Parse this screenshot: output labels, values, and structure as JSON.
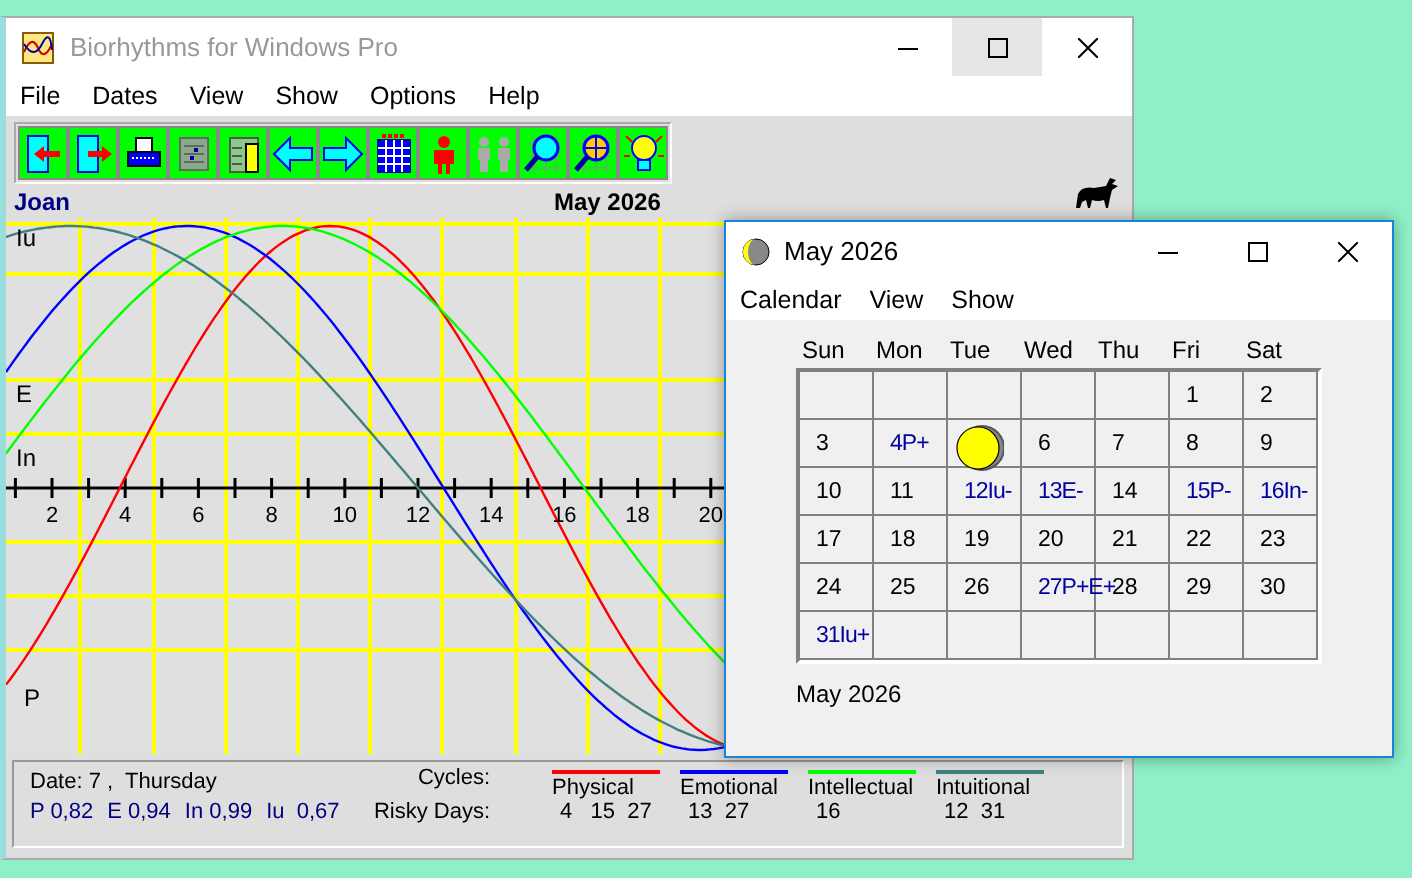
{
  "main_window": {
    "title": "Biorhythms for Windows Pro",
    "menu": [
      "File",
      "Dates",
      "View",
      "Show",
      "Options",
      "Help"
    ],
    "person": "Joan",
    "month": "May 2026",
    "chart": {
      "curve_labels": [
        "Iu",
        "E",
        "In",
        "P"
      ],
      "x_labels": [
        "2",
        "4",
        "6",
        "8",
        "10",
        "12",
        "14",
        "16",
        "18",
        "20"
      ]
    },
    "status": {
      "date": "Date: 7 ,  Thursday",
      "readings": [
        "P 0,82",
        "E 0,94",
        "In 0,99",
        "Iu  0,67"
      ],
      "cycles_label": "Cycles:",
      "risky_label": "Risky Days:",
      "cycles": [
        {
          "name": "Physical",
          "color": "#ff0000",
          "risky_days": "4   15  27"
        },
        {
          "name": "Emotional",
          "color": "#0000ff",
          "risky_days": "13  27"
        },
        {
          "name": "Intellectual",
          "color": "#00ff00",
          "risky_days": "16"
        },
        {
          "name": "Intuitional",
          "color": "#408080",
          "risky_days": "12  31"
        }
      ]
    }
  },
  "calendar_window": {
    "title": "May 2026",
    "menu": [
      "Calendar",
      "View",
      "Show"
    ],
    "weekdays": [
      "Sun",
      "Mon",
      "Tue",
      "Wed",
      "Thu",
      "Fri",
      "Sat"
    ],
    "weeks": [
      [
        {
          "kind": "blank"
        },
        {
          "kind": "blank"
        },
        {
          "kind": "blank"
        },
        {
          "kind": "blank"
        },
        {
          "kind": "blank"
        },
        {
          "kind": "day",
          "text": "1",
          "risky": false
        },
        {
          "kind": "day",
          "text": "2",
          "risky": false
        }
      ],
      [
        {
          "kind": "day",
          "text": "3",
          "risky": false
        },
        {
          "kind": "day",
          "text": "4P+",
          "risky": true
        },
        {
          "kind": "moon"
        },
        {
          "kind": "day",
          "text": "6",
          "risky": false
        },
        {
          "kind": "day",
          "text": "7",
          "risky": false
        },
        {
          "kind": "day",
          "text": "8",
          "risky": false
        },
        {
          "kind": "day",
          "text": "9",
          "risky": false
        }
      ],
      [
        {
          "kind": "day",
          "text": "10",
          "risky": false
        },
        {
          "kind": "day",
          "text": "11",
          "risky": false
        },
        {
          "kind": "day",
          "text": "12Iu-",
          "risky": true
        },
        {
          "kind": "day",
          "text": "13E-",
          "risky": true
        },
        {
          "kind": "day",
          "text": "14",
          "risky": false
        },
        {
          "kind": "day",
          "text": "15P-",
          "risky": true
        },
        {
          "kind": "day",
          "text": "16In-",
          "risky": true
        }
      ],
      [
        {
          "kind": "day",
          "text": "17",
          "risky": false
        },
        {
          "kind": "day",
          "text": "18",
          "risky": false
        },
        {
          "kind": "day",
          "text": "19",
          "risky": false
        },
        {
          "kind": "day",
          "text": "20",
          "risky": false
        },
        {
          "kind": "day",
          "text": "21",
          "risky": false
        },
        {
          "kind": "day",
          "text": "22",
          "risky": false
        },
        {
          "kind": "day",
          "text": "23",
          "risky": false
        }
      ],
      [
        {
          "kind": "day",
          "text": "24",
          "risky": false
        },
        {
          "kind": "day",
          "text": "25",
          "risky": false
        },
        {
          "kind": "day",
          "text": "26",
          "risky": false
        },
        {
          "kind": "day",
          "text": "27P+E+",
          "risky": true
        },
        {
          "kind": "day",
          "text": "28",
          "risky": false
        },
        {
          "kind": "day",
          "text": "29",
          "risky": false
        },
        {
          "kind": "day",
          "text": "30",
          "risky": false
        }
      ],
      [
        {
          "kind": "day",
          "text": "31Iu+",
          "risky": true
        },
        {
          "kind": "blank"
        },
        {
          "kind": "blank"
        },
        {
          "kind": "blank"
        },
        {
          "kind": "blank"
        },
        {
          "kind": "blank"
        },
        {
          "kind": "blank"
        }
      ]
    ],
    "footer": "May 2026"
  }
}
